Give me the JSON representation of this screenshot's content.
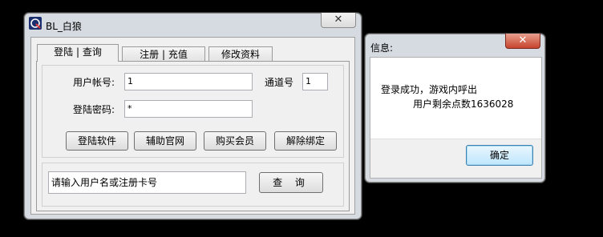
{
  "main_window": {
    "title": "BL_白狼",
    "close_glyph": "✕",
    "tabs": [
      {
        "label": "登陆 | 查询"
      },
      {
        "label": "注册 | 充值"
      },
      {
        "label": "修改资料"
      }
    ],
    "form": {
      "account_label": "用户帐号:",
      "account_value": "1",
      "channel_label": "通道号",
      "channel_value": "1",
      "password_label": "登陆密码:",
      "password_value": "*"
    },
    "buttons": {
      "login": "登陆软件",
      "website": "辅助官网",
      "buy_member": "购买会员",
      "unbind": "解除绑定"
    },
    "query": {
      "placeholder": "请输入用户名或注册卡号",
      "button": "查 询"
    }
  },
  "dialog": {
    "title": "信息:",
    "close_glyph": "✕",
    "message_line1": "登录成功，游戏内呼出",
    "message_line2": "用户剩余点数1636028",
    "ok_button": "确定"
  }
}
